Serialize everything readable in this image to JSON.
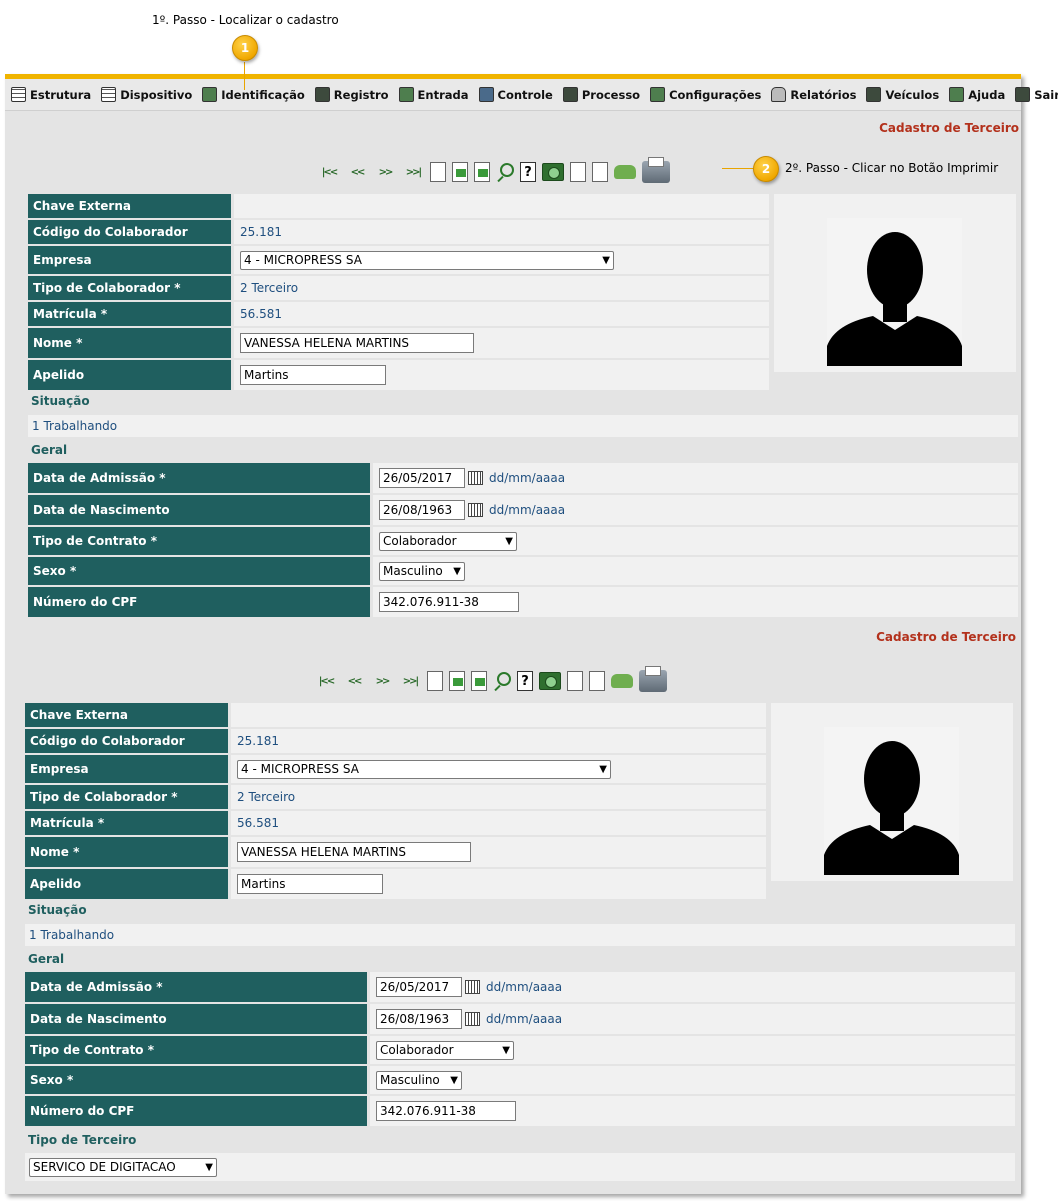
{
  "annotations": {
    "step1_badge": "1",
    "step1_text": "1º. Passo - Localizar o cadastro",
    "step2_badge": "2",
    "step2_text": "2º. Passo - Clicar no Botão Imprimir"
  },
  "menu": [
    {
      "label": "Estrutura",
      "icon": "grid-icon"
    },
    {
      "label": "Dispositivo",
      "icon": "device-icon"
    },
    {
      "label": "Identificação",
      "icon": "people-icon"
    },
    {
      "label": "Registro",
      "icon": "register-icon"
    },
    {
      "label": "Entrada",
      "icon": "entry-icon"
    },
    {
      "label": "Controle",
      "icon": "person-icon"
    },
    {
      "label": "Processo",
      "icon": "tools-icon"
    },
    {
      "label": "Configurações",
      "icon": "config-icon"
    },
    {
      "label": "Relatórios",
      "icon": "lock-icon"
    },
    {
      "label": "Veículos",
      "icon": "vehicle-icon"
    },
    {
      "label": "Ajuda",
      "icon": "help-icon"
    },
    {
      "label": "Sair",
      "icon": "exit-icon"
    }
  ],
  "form": {
    "title": "Cadastro de Terceiro",
    "chave_externa_label": "Chave Externa",
    "chave_externa_value": "",
    "codigo_label": "Código do Colaborador",
    "codigo_value": "25.181",
    "empresa_label": "Empresa",
    "empresa_value": "4 - MICROPRESS SA",
    "tipo_colab_label": "Tipo de Colaborador *",
    "tipo_colab_value": "2 Terceiro",
    "matricula_label": "Matrícula *",
    "matricula_value": "56.581",
    "nome_label": "Nome *",
    "nome_value": "VANESSA HELENA MARTINS",
    "apelido_label": "Apelido",
    "apelido_value": "Martins",
    "situacao_label": "Situação",
    "situacao_value": "1 Trabalhando",
    "geral_label": "Geral",
    "admissao_label": "Data de Admissão *",
    "admissao_value": "26/05/2017",
    "nascimento_label": "Data de Nascimento",
    "nascimento_value": "26/08/1963",
    "date_hint": "dd/mm/aaaa",
    "contrato_label": "Tipo de Contrato *",
    "contrato_value": "Colaborador",
    "sexo_label": "Sexo *",
    "sexo_value": "Masculino",
    "cpf_label": "Número do CPF",
    "cpf_value": "342.076.911-38",
    "tipo_terceiro_label": "Tipo de Terceiro",
    "tipo_terceiro_value": "SERVICO DE DIGITACAO"
  },
  "toolbar_icons": [
    "first-icon",
    "prev-icon",
    "next-icon",
    "last-icon",
    "new-doc-icon",
    "save-icon",
    "undo-icon",
    "search-icon",
    "help-icon",
    "camera-icon",
    "edit-doc-icon",
    "report-icon",
    "car-icon",
    "printer-icon"
  ]
}
